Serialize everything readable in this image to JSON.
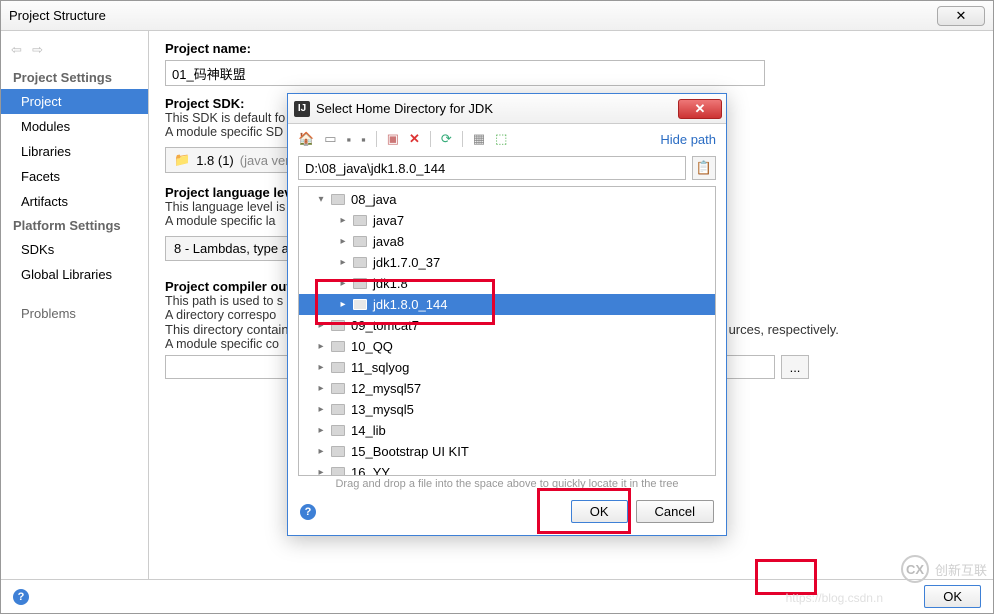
{
  "window": {
    "title": "Project Structure",
    "close_glyph": "✕"
  },
  "sidebar": {
    "nav_back": "⇦",
    "nav_fwd": "⇨",
    "head1": "Project Settings",
    "items1": [
      "Project",
      "Modules",
      "Libraries",
      "Facets",
      "Artifacts"
    ],
    "head2": "Platform Settings",
    "items2": [
      "SDKs",
      "Global Libraries"
    ],
    "problems": "Problems"
  },
  "content": {
    "name_label": "Project name:",
    "name_value": "01_码神联盟",
    "sdk_label": "Project SDK:",
    "sdk_tip1": "This SDK is default fo",
    "sdk_tip2": "A module specific SD",
    "sdk_combo_icon": "📁",
    "sdk_combo_text": "1.8 (1)",
    "sdk_combo_ver": "(java vers",
    "lang_label": "Project language lev",
    "lang_tip1": "This language level is",
    "lang_tip2": "A module specific la",
    "lang_combo": "8 - Lambdas, type a",
    "out_label": "Project compiler out",
    "out_tip1": "This path is used to s",
    "out_tip2": "A directory correspo",
    "out_tip3": "This directory contain",
    "out_tip3b": "urces, respectively.",
    "out_tip4": "A module specific co",
    "browse": "..."
  },
  "dialog": {
    "title": "Select Home Directory for JDK",
    "close_glyph": "✕",
    "hide_path": "Hide path",
    "path": "D:\\08_java\\jdk1.8.0_144",
    "hist_glyph": "📋",
    "hint": "Drag and drop a file into the space above to quickly locate it in the tree",
    "ok": "OK",
    "cancel": "Cancel",
    "tree": [
      {
        "lv": 1,
        "tw": "▾",
        "name": "08_java",
        "gray": true
      },
      {
        "lv": 2,
        "tw": "▸",
        "name": "java7",
        "gray": true
      },
      {
        "lv": 2,
        "tw": "▸",
        "name": "java8",
        "gray": true
      },
      {
        "lv": 2,
        "tw": "▸",
        "name": "jdk1.7.0_37",
        "gray": true
      },
      {
        "lv": 2,
        "tw": "▸",
        "name": "jdk1.8",
        "gray": true
      },
      {
        "lv": 2,
        "tw": "▸",
        "name": "jdk1.8.0_144",
        "sel": true
      },
      {
        "lv": 1,
        "tw": "▸",
        "name": "09_tomcat7",
        "gray": true
      },
      {
        "lv": 1,
        "tw": "▸",
        "name": "10_QQ",
        "gray": true
      },
      {
        "lv": 1,
        "tw": "▸",
        "name": "11_sqlyog",
        "gray": true
      },
      {
        "lv": 1,
        "tw": "▸",
        "name": "12_mysql57",
        "gray": true
      },
      {
        "lv": 1,
        "tw": "▸",
        "name": "13_mysql5",
        "gray": true
      },
      {
        "lv": 1,
        "tw": "▸",
        "name": "14_lib",
        "gray": true
      },
      {
        "lv": 1,
        "tw": "▸",
        "name": "15_Bootstrap UI KIT",
        "gray": true
      },
      {
        "lv": 1,
        "tw": "▸",
        "name": "16_YY",
        "gray": true
      }
    ]
  },
  "footer": {
    "ok": "OK"
  },
  "watermark": {
    "brand": "创新互联",
    "url": "https://blog.csdn.n"
  }
}
